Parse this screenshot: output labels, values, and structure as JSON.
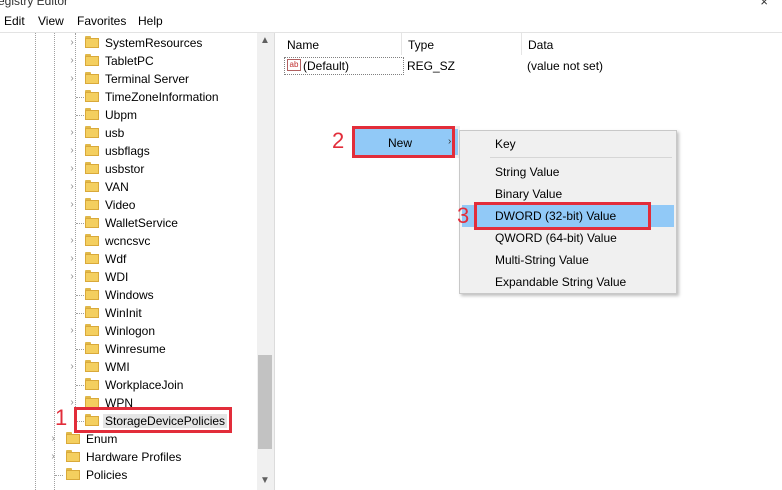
{
  "window": {
    "title": "egistry Editor",
    "close_glyph": "×"
  },
  "menu": [
    "Edit",
    "View",
    "Favorites",
    "Help"
  ],
  "tree": {
    "items": [
      {
        "label": "SystemResources",
        "has_children": true
      },
      {
        "label": "TabletPC",
        "has_children": true
      },
      {
        "label": "Terminal Server",
        "has_children": true
      },
      {
        "label": "TimeZoneInformation",
        "has_children": false
      },
      {
        "label": "Ubpm",
        "has_children": false
      },
      {
        "label": "usb",
        "has_children": true
      },
      {
        "label": "usbflags",
        "has_children": true
      },
      {
        "label": "usbstor",
        "has_children": true
      },
      {
        "label": "VAN",
        "has_children": true
      },
      {
        "label": "Video",
        "has_children": true
      },
      {
        "label": "WalletService",
        "has_children": false
      },
      {
        "label": "wcncsvc",
        "has_children": true
      },
      {
        "label": "Wdf",
        "has_children": true
      },
      {
        "label": "WDI",
        "has_children": true
      },
      {
        "label": "Windows",
        "has_children": false
      },
      {
        "label": "WinInit",
        "has_children": false
      },
      {
        "label": "Winlogon",
        "has_children": true
      },
      {
        "label": "Winresume",
        "has_children": false
      },
      {
        "label": "WMI",
        "has_children": true
      },
      {
        "label": "WorkplaceJoin",
        "has_children": false
      },
      {
        "label": "WPN",
        "has_children": true
      },
      {
        "label": "StorageDevicePolicies",
        "has_children": false,
        "selected": true
      }
    ],
    "root_items": [
      {
        "label": "Enum",
        "has_children": true
      },
      {
        "label": "Hardware Profiles",
        "has_children": true
      },
      {
        "label": "Policies",
        "has_children": false
      }
    ]
  },
  "list": {
    "columns": [
      "Name",
      "Type",
      "Data"
    ],
    "rows": [
      {
        "name": "(Default)",
        "type": "REG_SZ",
        "data": "(value not set)"
      }
    ]
  },
  "context_menu": {
    "new_label": "New",
    "submenu": [
      "Key",
      "String Value",
      "Binary Value",
      "DWORD (32-bit) Value",
      "QWORD (64-bit) Value",
      "Multi-String Value",
      "Expandable String Value"
    ],
    "highlighted": "DWORD (32-bit) Value"
  },
  "annotations": {
    "step1": "1",
    "step2": "2",
    "step3": "3",
    "color": "#e22d3a"
  },
  "icons": {
    "submenu_arrow": "›",
    "expand": "›",
    "scroll_up": "▲",
    "scroll_down": "▼",
    "value_icon": "ab"
  }
}
